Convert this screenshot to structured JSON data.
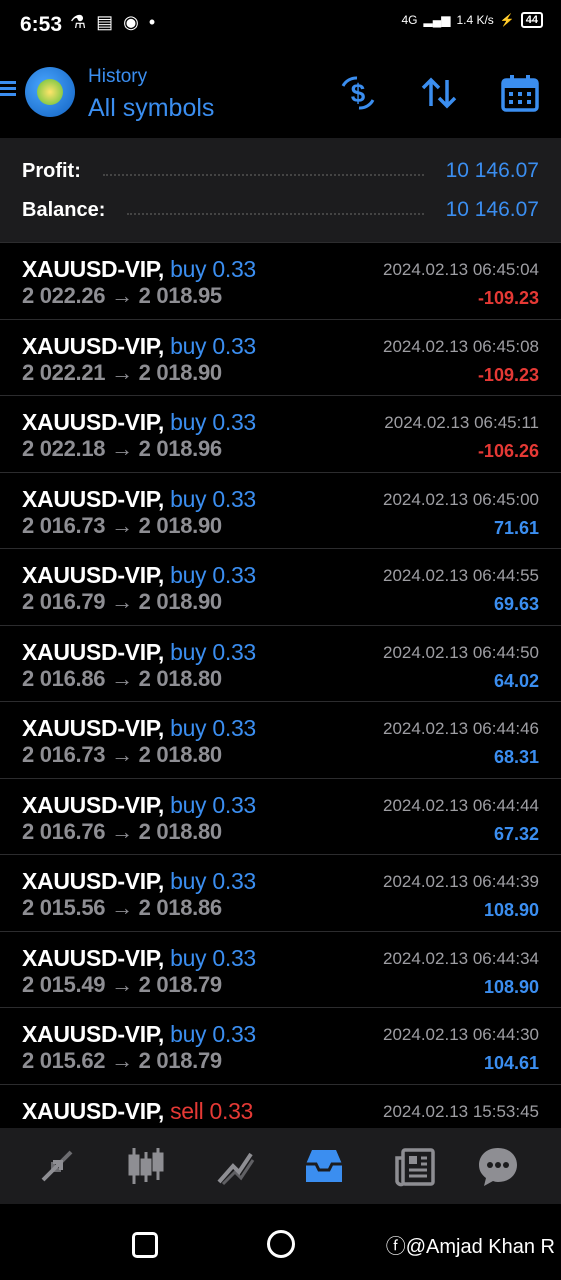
{
  "status": {
    "time": "6:53",
    "network": "4G",
    "speed": "1.4 K/s",
    "battery": "44"
  },
  "header": {
    "subtitle": "History",
    "title": "All symbols"
  },
  "summary": {
    "profit_label": "Profit:",
    "profit_value": "10 146.07",
    "balance_label": "Balance:",
    "balance_value": "10 146.07"
  },
  "trades": [
    {
      "symbol": "XAUUSD-VIP,",
      "dir": "buy",
      "volume": "0.33",
      "open": "2 022.26",
      "arrow": "→",
      "close": "2 018.95",
      "time": "2024.02.13 06:45:04",
      "pl": "-109.23",
      "neg": true
    },
    {
      "symbol": "XAUUSD-VIP,",
      "dir": "buy",
      "volume": "0.33",
      "open": "2 022.21",
      "arrow": "→",
      "close": "2 018.90",
      "time": "2024.02.13 06:45:08",
      "pl": "-109.23",
      "neg": true
    },
    {
      "symbol": "XAUUSD-VIP,",
      "dir": "buy",
      "volume": "0.33",
      "open": "2 022.18",
      "arrow": "→",
      "close": "2 018.96",
      "time": "2024.02.13 06:45:11",
      "pl": "-106.26",
      "neg": true
    },
    {
      "symbol": "XAUUSD-VIP,",
      "dir": "buy",
      "volume": "0.33",
      "open": "2 016.73",
      "arrow": "→",
      "close": "2 018.90",
      "time": "2024.02.13 06:45:00",
      "pl": "71.61",
      "neg": false
    },
    {
      "symbol": "XAUUSD-VIP,",
      "dir": "buy",
      "volume": "0.33",
      "open": "2 016.79",
      "arrow": "→",
      "close": "2 018.90",
      "time": "2024.02.13 06:44:55",
      "pl": "69.63",
      "neg": false
    },
    {
      "symbol": "XAUUSD-VIP,",
      "dir": "buy",
      "volume": "0.33",
      "open": "2 016.86",
      "arrow": "→",
      "close": "2 018.80",
      "time": "2024.02.13 06:44:50",
      "pl": "64.02",
      "neg": false
    },
    {
      "symbol": "XAUUSD-VIP,",
      "dir": "buy",
      "volume": "0.33",
      "open": "2 016.73",
      "arrow": "→",
      "close": "2 018.80",
      "time": "2024.02.13 06:44:46",
      "pl": "68.31",
      "neg": false
    },
    {
      "symbol": "XAUUSD-VIP,",
      "dir": "buy",
      "volume": "0.33",
      "open": "2 016.76",
      "arrow": "→",
      "close": "2 018.80",
      "time": "2024.02.13 06:44:44",
      "pl": "67.32",
      "neg": false
    },
    {
      "symbol": "XAUUSD-VIP,",
      "dir": "buy",
      "volume": "0.33",
      "open": "2 015.56",
      "arrow": "→",
      "close": "2 018.86",
      "time": "2024.02.13 06:44:39",
      "pl": "108.90",
      "neg": false
    },
    {
      "symbol": "XAUUSD-VIP,",
      "dir": "buy",
      "volume": "0.33",
      "open": "2 015.49",
      "arrow": "→",
      "close": "2 018.79",
      "time": "2024.02.13 06:44:34",
      "pl": "108.90",
      "neg": false
    },
    {
      "symbol": "XAUUSD-VIP,",
      "dir": "buy",
      "volume": "0.33",
      "open": "2 015.62",
      "arrow": "→",
      "close": "2 018.79",
      "time": "2024.02.13 06:44:30",
      "pl": "104.61",
      "neg": false
    },
    {
      "symbol": "XAUUSD-VIP,",
      "dir": "sell",
      "volume": "0.33",
      "open": "",
      "arrow": "",
      "close": "",
      "time": "2024.02.13 15:53:45",
      "pl": "",
      "neg": false
    }
  ],
  "tabs": [
    "quotes-icon",
    "chart-icon",
    "trade-icon",
    "history-icon",
    "news-icon",
    "messages-icon"
  ],
  "active_tab": "history-icon",
  "colors": {
    "accent": "#3b8ef0",
    "loss": "#e53935",
    "panel": "#1c1c1e"
  },
  "watermark": "@Amjad Khan R"
}
